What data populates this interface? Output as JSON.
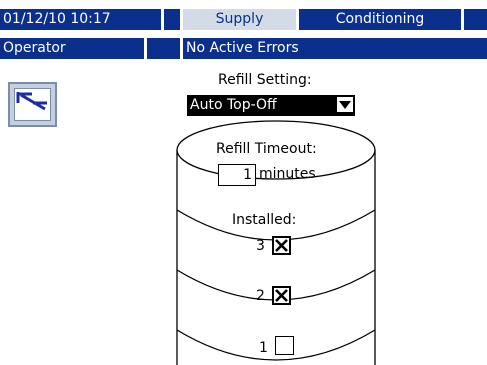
{
  "header": {
    "datetime": "01/12/10 10:17",
    "tabs": [
      {
        "label": "Supply",
        "active": true
      },
      {
        "label": "Conditioning",
        "active": false
      }
    ],
    "user": "Operator",
    "status": "No Active Errors"
  },
  "tool_button": {
    "icon": "tank-level-icon"
  },
  "refill": {
    "setting_label": "Refill Setting:",
    "setting_value": "Auto Top-Off",
    "timeout_label": "Refill Timeout:",
    "timeout_value": "1",
    "timeout_unit": "minutes",
    "installed_label": "Installed:",
    "drums": [
      {
        "number": "3",
        "installed": true
      },
      {
        "number": "2",
        "installed": true
      },
      {
        "number": "1",
        "installed": false
      }
    ]
  },
  "colors": {
    "header_bg": "#0a2f8c",
    "active_tab_bg": "#d3dbe7",
    "select_bg": "#000000"
  }
}
